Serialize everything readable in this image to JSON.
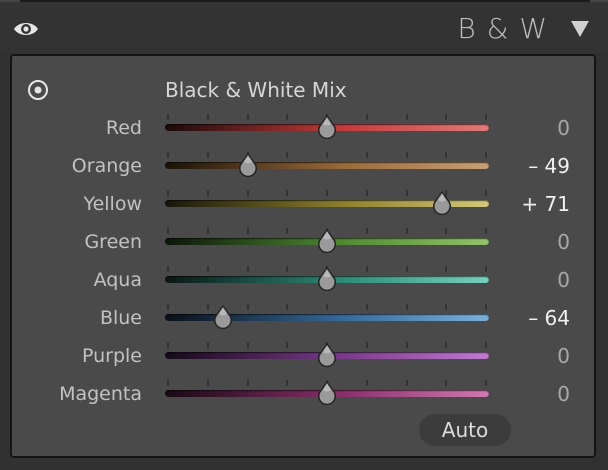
{
  "header": {
    "title": "B & W",
    "visibility_icon": "eye-icon",
    "collapse_icon": "triangle-down-icon"
  },
  "mix": {
    "title": "Black & White Mix",
    "target_icon": "target-adjust-icon",
    "min": -100,
    "max": 100,
    "channels": [
      {
        "label": "Red",
        "value": 0,
        "display": "0",
        "colors": [
          "#1a0a0a",
          "#c43b3b",
          "#e07a7a"
        ]
      },
      {
        "label": "Orange",
        "value": -49,
        "display": "– 49",
        "colors": [
          "#1a1208",
          "#9a6a3a",
          "#c8a074"
        ]
      },
      {
        "label": "Yellow",
        "value": 71,
        "display": "+ 71",
        "colors": [
          "#18160a",
          "#8c7f2e",
          "#d4c87a"
        ]
      },
      {
        "label": "Green",
        "value": 0,
        "display": "0",
        "colors": [
          "#0c160a",
          "#4f8a32",
          "#93c26c"
        ]
      },
      {
        "label": "Aqua",
        "value": 0,
        "display": "0",
        "colors": [
          "#0a1614",
          "#2f8a78",
          "#7ad0bf"
        ]
      },
      {
        "label": "Blue",
        "value": -64,
        "display": "– 64",
        "colors": [
          "#0a0f18",
          "#356a9a",
          "#7ab0d8"
        ]
      },
      {
        "label": "Purple",
        "value": 0,
        "display": "0",
        "colors": [
          "#150a18",
          "#7a3a8a",
          "#c07ad0"
        ]
      },
      {
        "label": "Magenta",
        "value": 0,
        "display": "0",
        "colors": [
          "#180a14",
          "#8a2f6a",
          "#d07ab0"
        ]
      }
    ]
  },
  "auto_label": "Auto"
}
